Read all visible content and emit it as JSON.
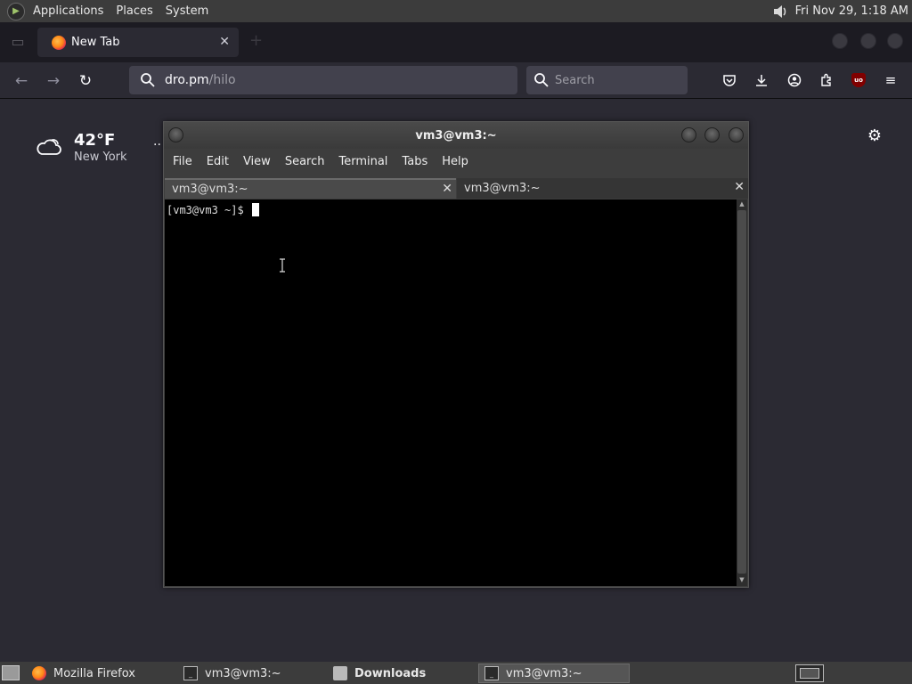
{
  "top_panel": {
    "menus": [
      "Applications",
      "Places",
      "System"
    ],
    "clock": "Fri Nov 29,  1:18 AM"
  },
  "browser": {
    "tab_title": "New Tab",
    "url_host": "dro.pm",
    "url_path": "/hilo",
    "search_placeholder": "Search",
    "weather": {
      "temperature": "42°F",
      "city": "New York",
      "more": "··"
    }
  },
  "terminal": {
    "title": "vm3@vm3:~",
    "menus": [
      "File",
      "Edit",
      "View",
      "Search",
      "Terminal",
      "Tabs",
      "Help"
    ],
    "tabs": [
      {
        "label": "vm3@vm3:~",
        "active": true
      },
      {
        "label": "vm3@vm3:~",
        "active": false
      }
    ],
    "prompt": "[vm3@vm3 ~]$ "
  },
  "taskbar": {
    "items": [
      {
        "label": "Mozilla Firefox",
        "icon": "firefox-icon",
        "active": false
      },
      {
        "label": "vm3@vm3:~",
        "icon": "terminal-icon",
        "active": false
      },
      {
        "label": "Downloads",
        "icon": "folder-icon",
        "active": false,
        "bold": true
      },
      {
        "label": "vm3@vm3:~",
        "icon": "terminal-icon",
        "active": true
      }
    ]
  },
  "colors": {
    "browser_bg": "#2b2a33",
    "panel_bg": "#3c3c3c",
    "terminal_bg": "#000000"
  }
}
